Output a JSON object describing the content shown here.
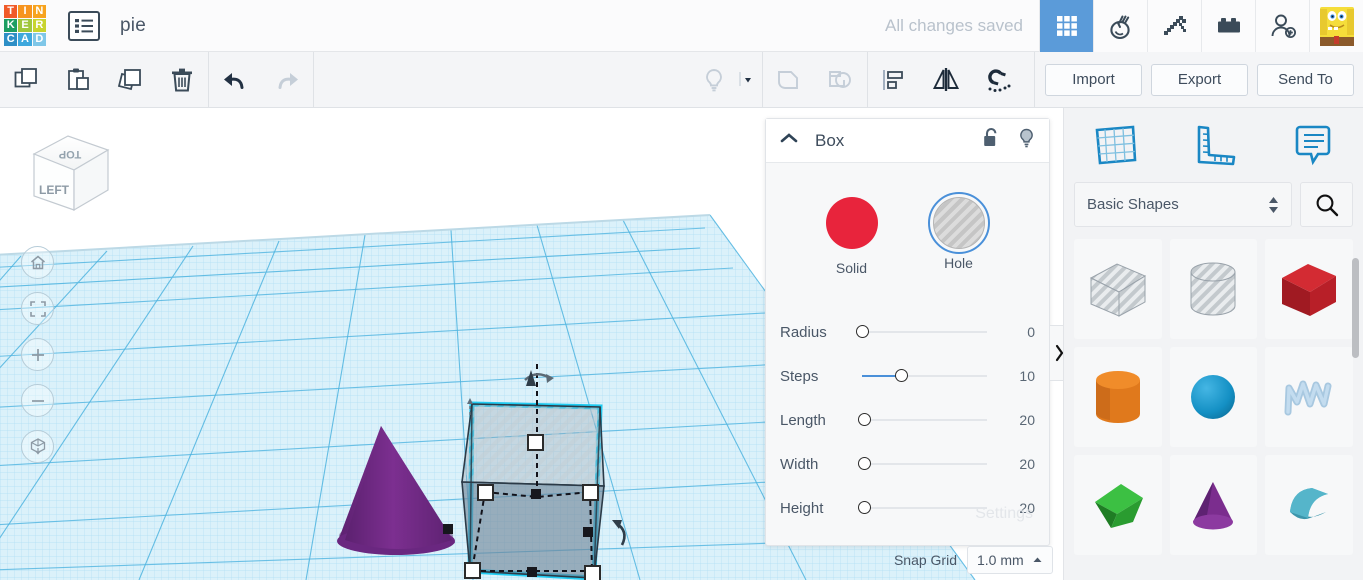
{
  "app": {
    "logo_letters": [
      "T",
      "I",
      "N",
      "K",
      "E",
      "R",
      "C",
      "A",
      "D"
    ],
    "logo_colors": [
      "#f05a28",
      "#f7941e",
      "#f7931e",
      "#1d9e62",
      "#9fc73c",
      "#c8d42e",
      "#2e8fc6",
      "#3ea8dd",
      "#7fc7e8"
    ],
    "document_title": "pie",
    "save_status": "All changes saved",
    "project_list_icon": "list-icon"
  },
  "topbar_icons": [
    {
      "name": "grid-3d-design-icon",
      "active": true
    },
    {
      "name": "codeblocks-icon",
      "active": false
    },
    {
      "name": "pickaxe-minecraft-icon",
      "active": false
    },
    {
      "name": "lego-brick-icon",
      "active": false
    },
    {
      "name": "add-person-icon",
      "active": false
    },
    {
      "name": "user-avatar-icon",
      "active": false
    }
  ],
  "toolbar": {
    "left_tools": [
      {
        "name": "copy-icon",
        "label": "Copy",
        "enabled": true
      },
      {
        "name": "paste-icon",
        "label": "Paste",
        "enabled": true
      },
      {
        "name": "duplicate-icon",
        "label": "Duplicate",
        "enabled": true
      },
      {
        "name": "delete-trash-icon",
        "label": "Delete",
        "enabled": true
      }
    ],
    "history_tools": [
      {
        "name": "undo-arrow-icon",
        "label": "Undo",
        "enabled": true
      },
      {
        "name": "redo-arrow-icon",
        "label": "Redo",
        "enabled": false
      }
    ],
    "center_tools": [
      {
        "name": "lightbulb-icon",
        "label": "Show/Hide",
        "enabled": false
      },
      {
        "name": "chevron-down-icon",
        "label": "More",
        "enabled": true
      },
      {
        "name": "group-icon",
        "label": "Group",
        "enabled": false
      },
      {
        "name": "ungroup-icon",
        "label": "Ungroup",
        "enabled": false
      },
      {
        "name": "align-icon",
        "label": "Align",
        "enabled": true
      },
      {
        "name": "mirror-icon",
        "label": "Mirror",
        "enabled": true
      },
      {
        "name": "magnet-snap-icon",
        "label": "Snap",
        "enabled": true
      }
    ],
    "import_label": "Import",
    "export_label": "Export",
    "sendto_label": "Send To"
  },
  "canvas": {
    "viewcube": {
      "top_face_label": "TOP",
      "front_face_label": "LEFT"
    },
    "nav_buttons": [
      {
        "name": "home-view-icon",
        "label": "Home view"
      },
      {
        "name": "fit-to-view-icon",
        "label": "Fit all in view"
      },
      {
        "name": "zoom-in-icon",
        "label": "Zoom in"
      },
      {
        "name": "zoom-out-icon",
        "label": "Zoom out"
      },
      {
        "name": "ortho-perspective-icon",
        "label": "Switch to orthographic/perspective view"
      }
    ],
    "objects": [
      {
        "name": "cone-shape",
        "type": "cone",
        "color": "#7b2d8e",
        "selected": false
      },
      {
        "name": "box-shape",
        "type": "box",
        "mode": "hole",
        "selected": true
      }
    ]
  },
  "properties": {
    "title": "Box",
    "collapse_icon": "chevron-up-icon",
    "lock_icon": "unlocked-padlock-icon",
    "visibility_icon": "lightbulb-icon",
    "collapse_panel_icon": "chevron-right-icon",
    "mode": {
      "solid_label": "Solid",
      "hole_label": "Hole",
      "selected": "Hole",
      "solid_color": "#e8243c",
      "highlight_color": "#4a90d9"
    },
    "sliders": [
      {
        "label": "Radius",
        "value": "0",
        "percent": 0
      },
      {
        "label": "Steps",
        "value": "10",
        "percent": 31
      },
      {
        "label": "Length",
        "value": "20",
        "percent": 0
      },
      {
        "label": "Width",
        "value": "20",
        "percent": 0
      },
      {
        "label": "Height",
        "value": "20",
        "percent": 0
      }
    ],
    "settings_label": "Settings"
  },
  "snap": {
    "label": "Snap Grid",
    "value": "1.0 mm",
    "caret_icon": "caret-up-icon"
  },
  "shapes_panel": {
    "tab_icons": [
      {
        "name": "workplane-grid-icon",
        "label": "Workplane"
      },
      {
        "name": "ruler-icon",
        "label": "Ruler"
      },
      {
        "name": "note-comment-icon",
        "label": "Note"
      }
    ],
    "category": "Basic Shapes",
    "search_icon": "search-magnifier-icon",
    "spinner_icon": "updown-caret-icon",
    "shapes": [
      {
        "name": "shape-box-hole",
        "label": "Box (hole)",
        "kind": "box-hole"
      },
      {
        "name": "shape-cylinder-hole",
        "label": "Cylinder (hole)",
        "kind": "cylinder-hole"
      },
      {
        "name": "shape-box",
        "label": "Box",
        "kind": "box",
        "color": "#c62027"
      },
      {
        "name": "shape-cylinder",
        "label": "Cylinder",
        "kind": "cylinder",
        "color": "#e2791d"
      },
      {
        "name": "shape-sphere",
        "label": "Sphere",
        "kind": "sphere",
        "color": "#1490c4"
      },
      {
        "name": "shape-scribble",
        "label": "Scribble",
        "kind": "scribble",
        "color": "#a8c8e0"
      },
      {
        "name": "shape-pyramid",
        "label": "Pyramid",
        "kind": "pyramid",
        "color": "#3aa93a"
      },
      {
        "name": "shape-cone",
        "label": "Cone",
        "kind": "cone",
        "color": "#7b2d8e"
      },
      {
        "name": "shape-roof",
        "label": "Roof",
        "kind": "roof",
        "color": "#45a9bd"
      }
    ]
  }
}
